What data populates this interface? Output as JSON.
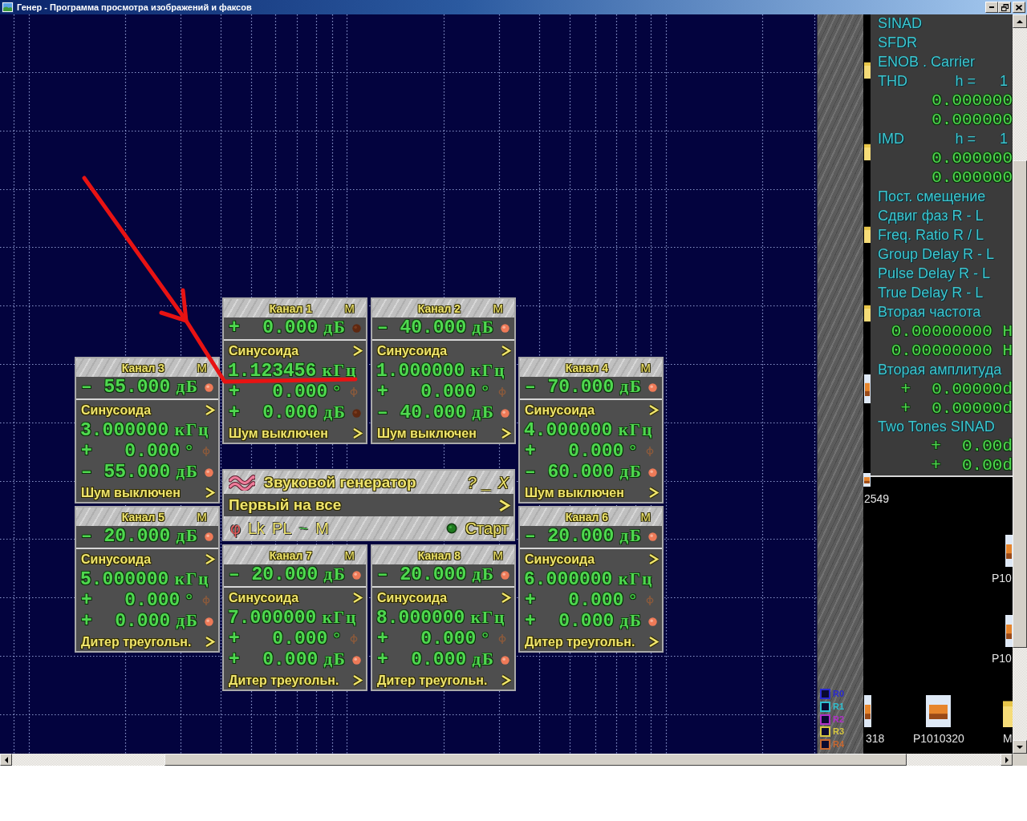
{
  "window": {
    "title": "Генер - Программа просмотра изображений и факсов"
  },
  "channels": [
    {
      "title": "Канал 1",
      "menu": "M",
      "lit": false,
      "level": {
        "sign": "+",
        "value": "0.000",
        "unit": "дБ"
      },
      "waveform": "Синусоида",
      "frequency": {
        "value": "1.123456",
        "unit": "кГц"
      },
      "phase": {
        "sign": "+",
        "value": "0.000",
        "unit": "°"
      },
      "amplitude": {
        "sign": "+",
        "value": "0.000",
        "unit": "дБ"
      },
      "noise": "Шум выключен"
    },
    {
      "title": "Канал 2",
      "menu": "M",
      "lit": true,
      "level": {
        "sign": "–",
        "value": "40.000",
        "unit": "дБ"
      },
      "waveform": "Синусоида",
      "frequency": {
        "value": "1.000000",
        "unit": "кГц"
      },
      "phase": {
        "sign": "+",
        "value": "0.000",
        "unit": "°"
      },
      "amplitude": {
        "sign": "–",
        "value": "40.000",
        "unit": "дБ"
      },
      "noise": "Шум выключен"
    },
    {
      "title": "Канал 3",
      "menu": "M",
      "lit": true,
      "level": {
        "sign": "–",
        "value": "55.000",
        "unit": "дБ"
      },
      "waveform": "Синусоида",
      "frequency": {
        "value": "3.000000",
        "unit": "кГц"
      },
      "phase": {
        "sign": "+",
        "value": "0.000",
        "unit": "°"
      },
      "amplitude": {
        "sign": "–",
        "value": "55.000",
        "unit": "дБ"
      },
      "noise": "Шум выключен"
    },
    {
      "title": "Канал 4",
      "menu": "M",
      "lit": true,
      "level": {
        "sign": "–",
        "value": "70.000",
        "unit": "дБ"
      },
      "waveform": "Синусоида",
      "frequency": {
        "value": "4.000000",
        "unit": "кГц"
      },
      "phase": {
        "sign": "+",
        "value": "0.000",
        "unit": "°"
      },
      "amplitude": {
        "sign": "–",
        "value": "60.000",
        "unit": "дБ"
      },
      "noise": "Шум выключен"
    },
    {
      "title": "Канал 5",
      "menu": "M",
      "lit": true,
      "level": {
        "sign": "–",
        "value": "20.000",
        "unit": "дБ"
      },
      "waveform": "Синусоида",
      "frequency": {
        "value": "5.000000",
        "unit": "кГц"
      },
      "phase": {
        "sign": "+",
        "value": "0.000",
        "unit": "°"
      },
      "amplitude": {
        "sign": "+",
        "value": "0.000",
        "unit": "дБ"
      },
      "noise": "Дитер треугольн."
    },
    {
      "title": "Канал 6",
      "menu": "M",
      "lit": true,
      "level": {
        "sign": "–",
        "value": "20.000",
        "unit": "дБ"
      },
      "waveform": "Синусоида",
      "frequency": {
        "value": "6.000000",
        "unit": "кГц"
      },
      "phase": {
        "sign": "+",
        "value": "0.000",
        "unit": "°"
      },
      "amplitude": {
        "sign": "+",
        "value": "0.000",
        "unit": "дБ"
      },
      "noise": "Дитер треугольн."
    },
    {
      "title": "Канал 7",
      "menu": "M",
      "lit": true,
      "level": {
        "sign": "–",
        "value": "20.000",
        "unit": "дБ"
      },
      "waveform": "Синусоида",
      "frequency": {
        "value": "7.000000",
        "unit": "кГц"
      },
      "phase": {
        "sign": "+",
        "value": "0.000",
        "unit": "°"
      },
      "amplitude": {
        "sign": "+",
        "value": "0.000",
        "unit": "дБ"
      },
      "noise": "Дитер треугольн."
    },
    {
      "title": "Канал 8",
      "menu": "M",
      "lit": true,
      "level": {
        "sign": "–",
        "value": "20.000",
        "unit": "дБ"
      },
      "waveform": "Синусоида",
      "frequency": {
        "value": "8.000000",
        "unit": "кГц"
      },
      "phase": {
        "sign": "+",
        "value": "0.000",
        "unit": "°"
      },
      "amplitude": {
        "sign": "+",
        "value": "0.000",
        "unit": "дБ"
      },
      "noise": "Дитер треугольн."
    }
  ],
  "generator": {
    "title": "Звуковой генератор",
    "window_buttons": [
      "?",
      "_",
      "X"
    ],
    "preset": "Первый на все",
    "toggles": [
      {
        "label": "φ",
        "kind": "phase"
      },
      {
        "label": "Lk",
        "kind": "plain"
      },
      {
        "label": "PL",
        "kind": "plain"
      },
      {
        "label": "~",
        "kind": "wave"
      },
      {
        "label": "M",
        "kind": "plain"
      }
    ],
    "start": "Старт"
  },
  "measurements": [
    {
      "kind": "label",
      "text": "SINAD"
    },
    {
      "kind": "label",
      "text": "SFDR"
    },
    {
      "kind": "label",
      "text": "ENOB . Carrier"
    },
    {
      "kind": "harmonic",
      "text": "THD",
      "param": "h =",
      "value": "1"
    },
    {
      "kind": "value",
      "value": "0.000000"
    },
    {
      "kind": "value",
      "value": "0.000000"
    },
    {
      "kind": "harmonic",
      "text": "IMD",
      "param": "h =",
      "value": "1"
    },
    {
      "kind": "value",
      "value": "0.000000"
    },
    {
      "kind": "value",
      "value": "0.000000"
    },
    {
      "kind": "label",
      "text": "Пост. смещение"
    },
    {
      "kind": "label",
      "text": "Сдвиг фаз R - L"
    },
    {
      "kind": "label",
      "text": "Freq. Ratio R / L"
    },
    {
      "kind": "label",
      "text": "Group Delay R - L"
    },
    {
      "kind": "label",
      "text": "Pulse Delay R - L"
    },
    {
      "kind": "label",
      "text": "True Delay R - L"
    },
    {
      "kind": "label",
      "text": "Вторая частота"
    },
    {
      "kind": "value",
      "value": "0.00000000",
      "unit": "H"
    },
    {
      "kind": "value",
      "value": "0.00000000",
      "unit": "H"
    },
    {
      "kind": "label",
      "text": "Вторая амплитуда"
    },
    {
      "kind": "signed",
      "sign": "+",
      "value": "0.00000",
      "unit": "d"
    },
    {
      "kind": "signed",
      "sign": "+",
      "value": "0.00000",
      "unit": "d"
    },
    {
      "kind": "label",
      "text": "Two Tones SINAD"
    },
    {
      "kind": "signed",
      "sign": "+",
      "value": "0.00",
      "unit": "d"
    },
    {
      "kind": "signed",
      "sign": "+",
      "value": "0.00",
      "unit": "d"
    }
  ],
  "legend": [
    {
      "label": "R0",
      "color": "#2a2ad0"
    },
    {
      "label": "R1",
      "color": "#30c0d0"
    },
    {
      "label": "R2",
      "color": "#b030c8"
    },
    {
      "label": "R3",
      "color": "#d8c840"
    },
    {
      "label": "R4",
      "color": "#c86830"
    }
  ],
  "desktop_icons": [
    {
      "label": "2549",
      "kind": "image"
    },
    {
      "label": "P10",
      "kind": "image"
    },
    {
      "label": "P10",
      "kind": "image"
    },
    {
      "label": "318",
      "kind": "image"
    },
    {
      "label": "P1010320",
      "kind": "image"
    },
    {
      "label": "M",
      "kind": "folder"
    }
  ]
}
